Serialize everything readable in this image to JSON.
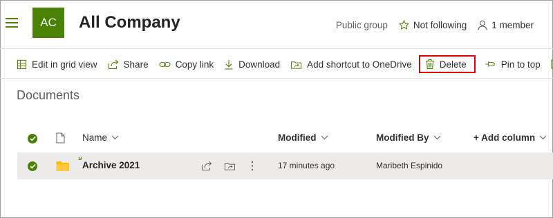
{
  "header": {
    "avatar_initials": "AC",
    "site_title": "All Company",
    "privacy": "Public group",
    "follow_label": "Not following",
    "members_label": "1 member"
  },
  "commands": [
    {
      "label": "Edit in grid view",
      "icon": "grid-icon"
    },
    {
      "label": "Share",
      "icon": "share-icon"
    },
    {
      "label": "Copy link",
      "icon": "link-icon"
    },
    {
      "label": "Download",
      "icon": "download-icon"
    },
    {
      "label": "Add shortcut to OneDrive",
      "icon": "shortcut-icon"
    },
    {
      "label": "Delete",
      "icon": "trash-icon",
      "highlighted": true
    },
    {
      "label": "Pin to top",
      "icon": "pin-icon"
    }
  ],
  "library": {
    "title": "Documents",
    "columns": {
      "name": "Name",
      "modified": "Modified",
      "modified_by": "Modified By",
      "add_column": "+ Add column"
    },
    "rows": [
      {
        "name": "Archive 2021",
        "modified": "17 minutes ago",
        "modified_by": "Maribeth Espinido",
        "selected": true,
        "type_icon": "folder-icon"
      }
    ]
  },
  "colors": {
    "accent": "#498205",
    "highlight_box": "#e00000",
    "row_selected_bg": "#edebe9",
    "folder": "#ffb900"
  }
}
